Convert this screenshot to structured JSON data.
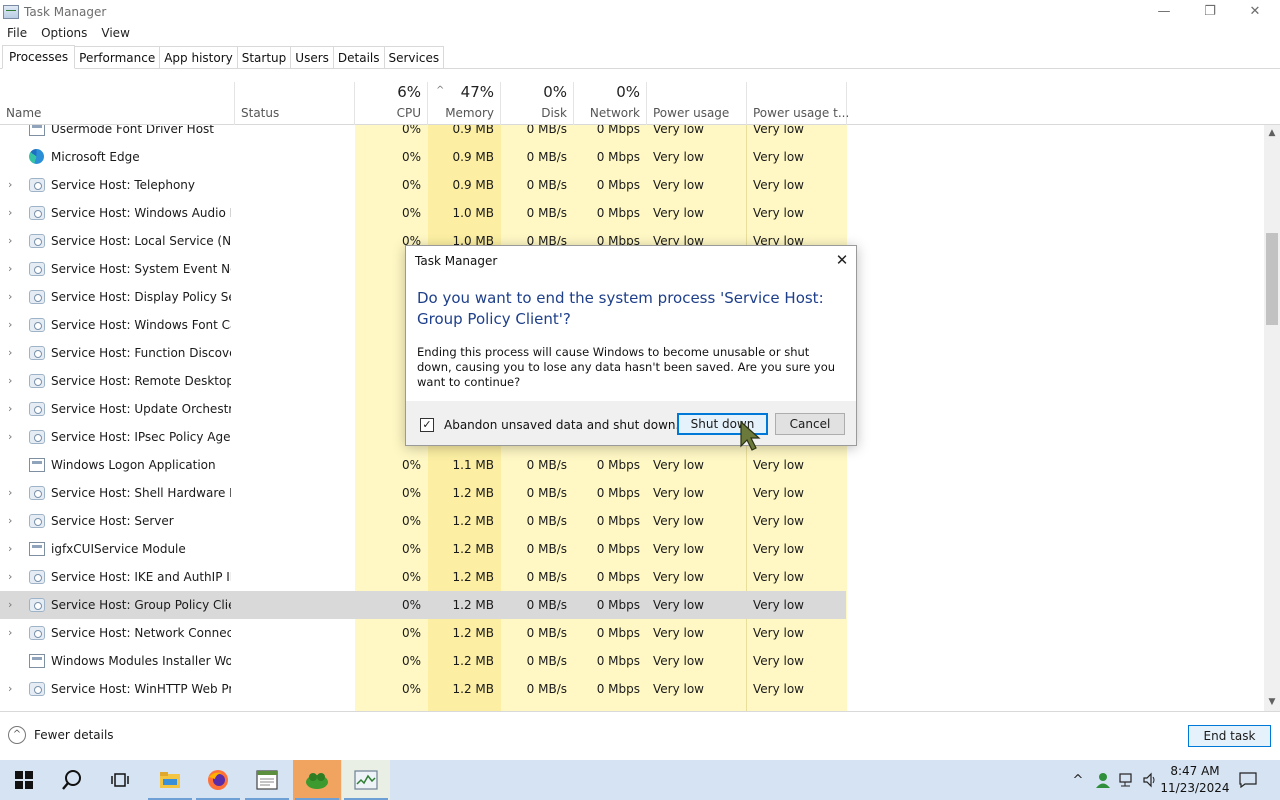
{
  "window": {
    "title": "Task Manager"
  },
  "menu": [
    "File",
    "Options",
    "View"
  ],
  "tabs": [
    "Processes",
    "Performance",
    "App history",
    "Startup",
    "Users",
    "Details",
    "Services"
  ],
  "columns": {
    "name": "Name",
    "status": "Status",
    "cpu": {
      "pct": "6%",
      "label": "CPU"
    },
    "memory": {
      "pct": "47%",
      "label": "Memory"
    },
    "disk": {
      "pct": "0%",
      "label": "Disk"
    },
    "network": {
      "pct": "0%",
      "label": "Network"
    },
    "power": "Power usage",
    "power_trend": "Power usage t..."
  },
  "rows": [
    {
      "name": "Usermode Font Driver Host",
      "icon": "window",
      "expand": false,
      "cpu": "0%",
      "mem": "0.9 MB",
      "disk": "0 MB/s",
      "net": "0 Mbps",
      "power": "Very low",
      "trend": "Very low"
    },
    {
      "name": "Microsoft Edge",
      "icon": "edge",
      "expand": false,
      "cpu": "0%",
      "mem": "0.9 MB",
      "disk": "0 MB/s",
      "net": "0 Mbps",
      "power": "Very low",
      "trend": "Very low"
    },
    {
      "name": "Service Host: Telephony",
      "icon": "gear",
      "expand": true,
      "cpu": "0%",
      "mem": "0.9 MB",
      "disk": "0 MB/s",
      "net": "0 Mbps",
      "power": "Very low",
      "trend": "Very low"
    },
    {
      "name": "Service Host: Windows Audio E...",
      "icon": "gear",
      "expand": true,
      "cpu": "0%",
      "mem": "1.0 MB",
      "disk": "0 MB/s",
      "net": "0 Mbps",
      "power": "Very low",
      "trend": "Very low"
    },
    {
      "name": "Service Host: Local Service (No ...",
      "icon": "gear",
      "expand": true,
      "cpu": "0%",
      "mem": "1.0 MB",
      "disk": "0 MB/s",
      "net": "0 Mbps",
      "power": "Very low",
      "trend": "Very low"
    },
    {
      "name": "Service Host: System Event Noti...",
      "icon": "gear",
      "expand": true,
      "cpu": "",
      "mem": "",
      "disk": "",
      "net": "",
      "power": "",
      "trend": ""
    },
    {
      "name": "Service Host: Display Policy Serv...",
      "icon": "gear",
      "expand": true,
      "cpu": "",
      "mem": "",
      "disk": "",
      "net": "",
      "power": "",
      "trend": ""
    },
    {
      "name": "Service Host: Windows Font Ca...",
      "icon": "gear",
      "expand": true,
      "cpu": "",
      "mem": "",
      "disk": "",
      "net": "",
      "power": "",
      "trend": ""
    },
    {
      "name": "Service Host: Function Discover...",
      "icon": "gear",
      "expand": true,
      "cpu": "",
      "mem": "",
      "disk": "",
      "net": "",
      "power": "",
      "trend": ""
    },
    {
      "name": "Service Host: Remote Desktop C...",
      "icon": "gear",
      "expand": true,
      "cpu": "",
      "mem": "",
      "disk": "",
      "net": "",
      "power": "",
      "trend": ""
    },
    {
      "name": "Service Host: Update Orchestrat...",
      "icon": "gear",
      "expand": true,
      "cpu": "",
      "mem": "",
      "disk": "",
      "net": "",
      "power": "",
      "trend": ""
    },
    {
      "name": "Service Host: IPsec Policy Agent",
      "icon": "gear",
      "expand": true,
      "cpu": "",
      "mem": "",
      "disk": "",
      "net": "",
      "power": "",
      "trend": ""
    },
    {
      "name": "Windows Logon Application",
      "icon": "window",
      "expand": false,
      "cpu": "0%",
      "mem": "1.1 MB",
      "disk": "0 MB/s",
      "net": "0 Mbps",
      "power": "Very low",
      "trend": "Very low"
    },
    {
      "name": "Service Host: Shell Hardware De...",
      "icon": "gear",
      "expand": true,
      "cpu": "0%",
      "mem": "1.2 MB",
      "disk": "0 MB/s",
      "net": "0 Mbps",
      "power": "Very low",
      "trend": "Very low"
    },
    {
      "name": "Service Host: Server",
      "icon": "gear",
      "expand": true,
      "cpu": "0%",
      "mem": "1.2 MB",
      "disk": "0 MB/s",
      "net": "0 Mbps",
      "power": "Very low",
      "trend": "Very low"
    },
    {
      "name": "igfxCUIService Module",
      "icon": "window",
      "expand": true,
      "cpu": "0%",
      "mem": "1.2 MB",
      "disk": "0 MB/s",
      "net": "0 Mbps",
      "power": "Very low",
      "trend": "Very low"
    },
    {
      "name": "Service Host: IKE and AuthIP IPs...",
      "icon": "gear",
      "expand": true,
      "cpu": "0%",
      "mem": "1.2 MB",
      "disk": "0 MB/s",
      "net": "0 Mbps",
      "power": "Very low",
      "trend": "Very low"
    },
    {
      "name": "Service Host: Group Policy Client",
      "icon": "gear",
      "expand": true,
      "selected": true,
      "cpu": "0%",
      "mem": "1.2 MB",
      "disk": "0 MB/s",
      "net": "0 Mbps",
      "power": "Very low",
      "trend": "Very low"
    },
    {
      "name": "Service Host: Network Connecti...",
      "icon": "gear",
      "expand": true,
      "cpu": "0%",
      "mem": "1.2 MB",
      "disk": "0 MB/s",
      "net": "0 Mbps",
      "power": "Very low",
      "trend": "Very low"
    },
    {
      "name": "Windows Modules Installer Wor...",
      "icon": "window",
      "expand": false,
      "cpu": "0%",
      "mem": "1.2 MB",
      "disk": "0 MB/s",
      "net": "0 Mbps",
      "power": "Very low",
      "trend": "Very low"
    },
    {
      "name": "Service Host: WinHTTP Web Pro...",
      "icon": "gear",
      "expand": true,
      "cpu": "0%",
      "mem": "1.2 MB",
      "disk": "0 MB/s",
      "net": "0 Mbps",
      "power": "Very low",
      "trend": "Very low"
    }
  ],
  "footer": {
    "fewer_details": "Fewer details",
    "end_task": "End task"
  },
  "dialog": {
    "title": "Task Manager",
    "heading": "Do you want to end the system process 'Service Host: Group Policy Client'?",
    "body": "Ending this process will cause Windows to become unusable or shut down, causing you to lose any data hasn't been saved. Are you sure you want to continue?",
    "checkbox_label": "Abandon unsaved data and shut down.",
    "checkbox_checked": true,
    "primary": "Shut down",
    "cancel": "Cancel"
  },
  "taskbar": {
    "apps": [
      "start-icon",
      "search-icon",
      "task-view-icon",
      "file-explorer-icon",
      "firefox-icon",
      "notepad-icon",
      "app-icon",
      "task-manager-icon"
    ],
    "time": "8:47 AM",
    "date": "11/23/2024"
  },
  "colors": {
    "accent": "#0078d7",
    "heat_light": "#fff8c4",
    "heat_mid": "#fcefa3",
    "selected": "#d9d9d9"
  }
}
